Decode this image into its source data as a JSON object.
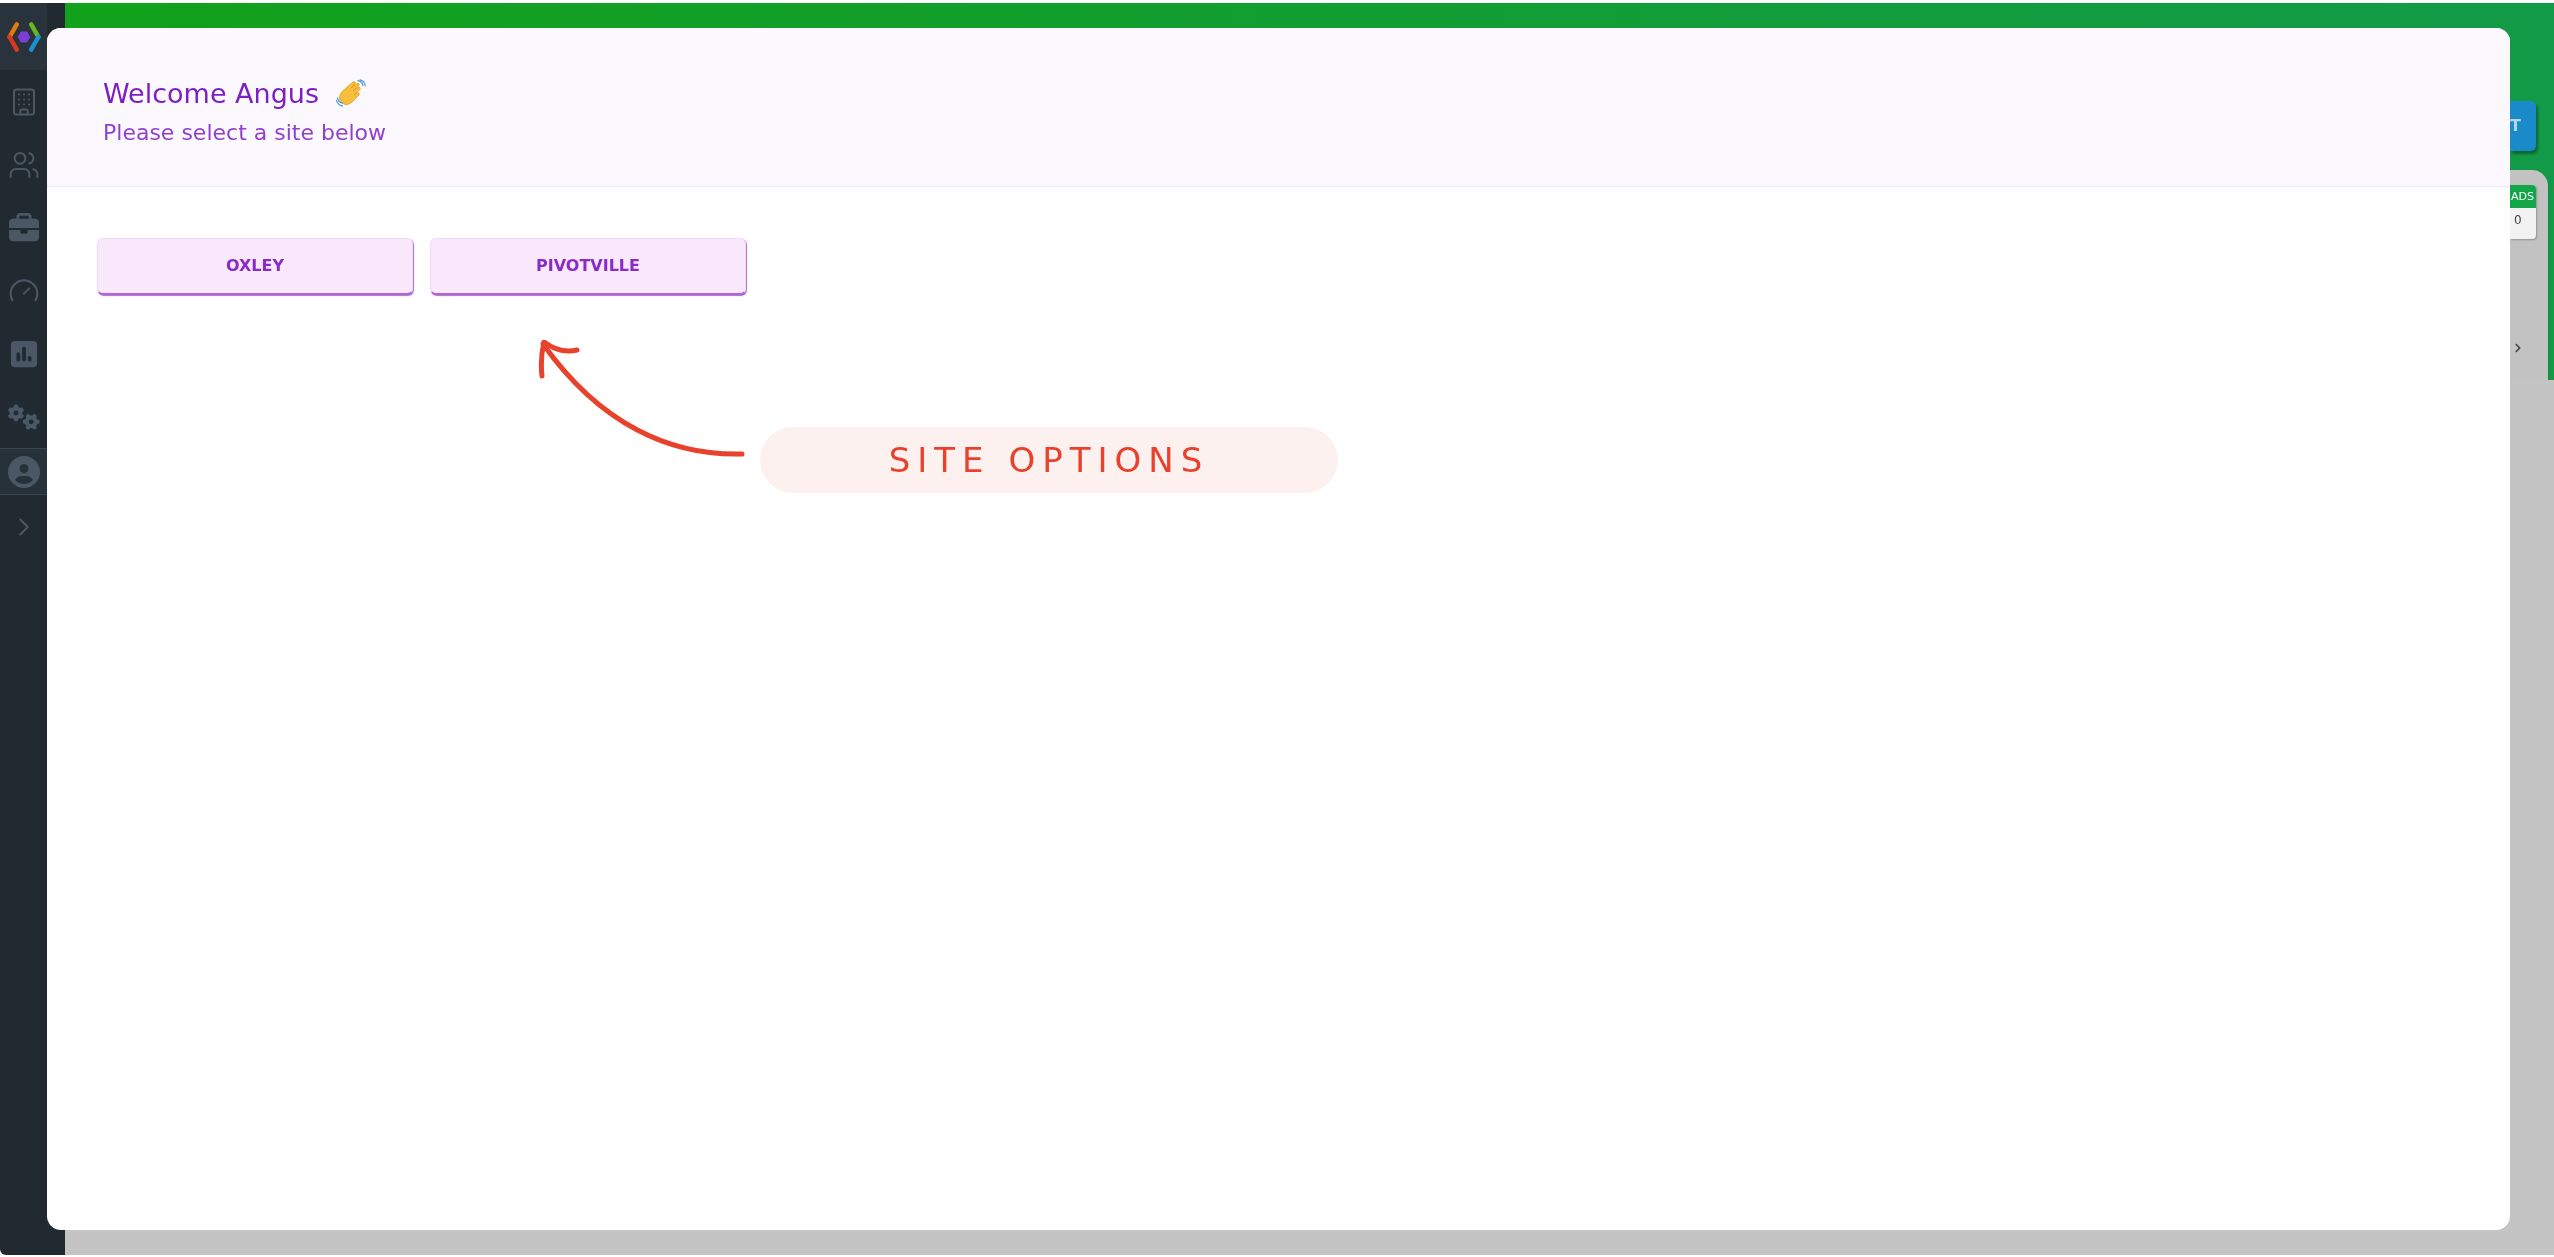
{
  "dialog": {
    "title": "Welcome Angus",
    "subtitle": "Please select a site below",
    "sites": [
      {
        "label": "OXLEY"
      },
      {
        "label": "PIVOTVILLE"
      }
    ]
  },
  "annotation": {
    "label": "SITE OPTIONS"
  },
  "background_page": {
    "button": "T",
    "card": {
      "badge": "ADS",
      "value": "0"
    }
  }
}
